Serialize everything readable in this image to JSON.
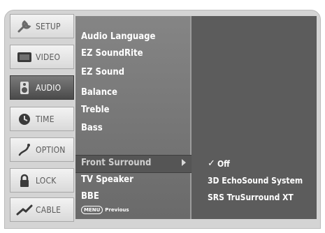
{
  "sidebar": {
    "items": [
      {
        "label": "SETUP",
        "icon": "wrench-icon"
      },
      {
        "label": "VIDEO",
        "icon": "tv-icon"
      },
      {
        "label": "AUDIO",
        "icon": "speaker-icon",
        "active": true
      },
      {
        "label": "TIME",
        "icon": "clock-icon"
      },
      {
        "label": "OPTION",
        "icon": "option-icon"
      },
      {
        "label": "LOCK",
        "icon": "lock-icon"
      },
      {
        "label": "CABLE",
        "icon": "cable-icon"
      }
    ]
  },
  "menu": {
    "items": [
      {
        "label": "Audio Language"
      },
      {
        "label": "EZ SoundRite"
      },
      {
        "label": "EZ Sound"
      },
      {
        "label": "Balance"
      },
      {
        "label": "Treble"
      },
      {
        "label": "Bass"
      },
      {
        "label": "Front Surround",
        "selected": true
      },
      {
        "label": "TV Speaker"
      },
      {
        "label": "BBE"
      }
    ],
    "footer": {
      "key_label": "MENU",
      "text": "Previous"
    }
  },
  "submenu": {
    "check_mark": "✓",
    "options": [
      {
        "label": "Off",
        "checked": true
      },
      {
        "label": "3D EchoSound System"
      },
      {
        "label": "SRS TruSurround XT"
      }
    ]
  },
  "colors": {
    "panel": "#5c5c5c",
    "menu_column": "#787878",
    "active_tab": "#4a4a4a",
    "frame": "#d4d4d4"
  }
}
